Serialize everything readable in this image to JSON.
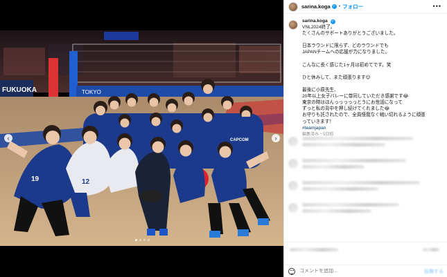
{
  "post": {
    "username": "sarina.koga",
    "follow_label": "フォロー",
    "more_label": "•••",
    "caption_lines": [
      "VNL2024終了。",
      "たくさんのサポートありがとうございました。",
      "",
      "日本ラウンドに限らず、どのラウンドでも",
      "JAPANチームへの応援が力になりました。",
      "",
      "こんなに長く感じた1ヶ月は初めてです。笑",
      "",
      "ひと休みして、また頑張ります😊",
      "",
      "最後に小原先生、",
      "20年以上女子バレーに尊同していただき感謝です😂",
      "東京の時はほんっっっっっとうにお世話になって",
      "ずっと私の背中を押し続けてくれました😂",
      "お守りも託されたので、全員怪我なく戦い切れるように頑張",
      "っていきます！",
      "#teamjapan"
    ],
    "meta": "編集済み・5日前",
    "comment_placeholder": "コメントを追加...",
    "post_label": "投稿する"
  },
  "photo": {
    "banner_left": "FUKUOKA",
    "banner_mid": "TOKYO",
    "jersey_numbers": [
      "19",
      "12"
    ],
    "sponsor": "CAPCOM",
    "colors": {
      "floor": "#c9a77f",
      "uniform_blue": "#1b3a8c",
      "uniform_white": "#e8eaf0",
      "crowd": "#3a2a2a"
    }
  },
  "icons": {
    "left_arrow": "‹",
    "right_arrow": "›",
    "verified": "✓"
  }
}
